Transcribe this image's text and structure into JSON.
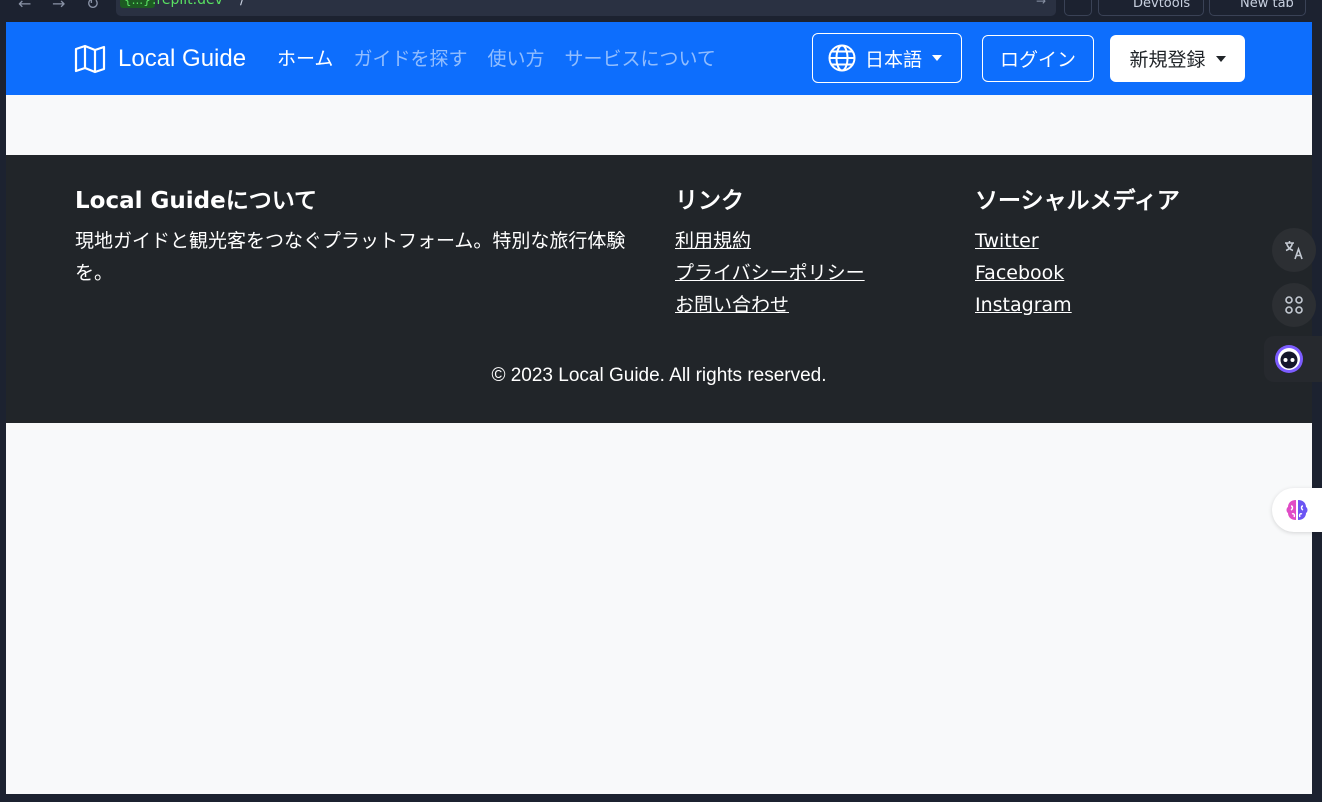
{
  "browser": {
    "url_badge": "{...}",
    "url_host": ".replit.dev",
    "url_path": "/",
    "devtools_label": "Devtools",
    "newtab_label": "New tab"
  },
  "navbar": {
    "brand": "Local Guide",
    "links": [
      "ホーム",
      "ガイドを探す",
      "使い方",
      "サービスについて"
    ],
    "language": "日本語",
    "login": "ログイン",
    "signup": "新規登録"
  },
  "footer": {
    "about": {
      "title": "Local Guideについて",
      "text": "現地ガイドと観光客をつなぐプラットフォーム。特別な旅行体験を。"
    },
    "links": {
      "title": "リンク",
      "items": [
        "利用規約",
        "プライバシーポリシー",
        "お問い合わせ"
      ]
    },
    "social": {
      "title": "ソーシャルメディア",
      "items": [
        "Twitter",
        "Facebook",
        "Instagram"
      ]
    },
    "copyright": "© 2023 Local Guide. All rights reserved."
  },
  "colors": {
    "primary": "#0d6efd",
    "footer_bg": "#212529",
    "page_bg": "#f8f9fa"
  }
}
